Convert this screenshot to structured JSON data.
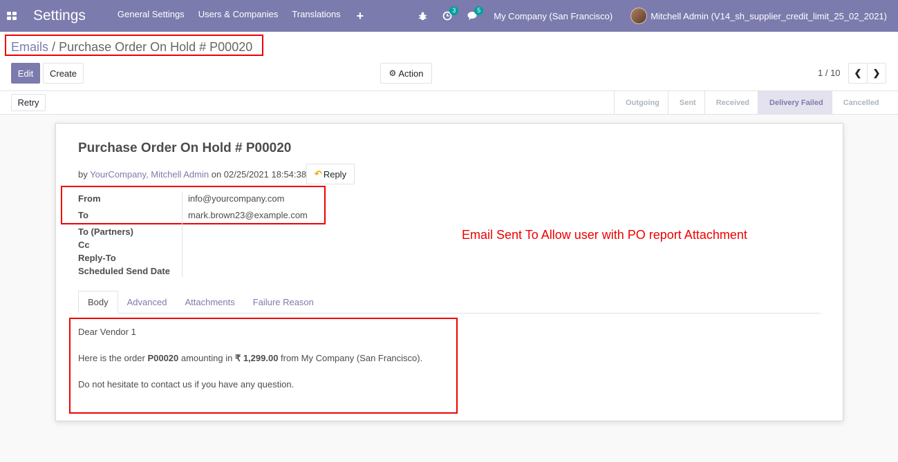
{
  "navbar": {
    "app_title": "Settings",
    "menu": [
      "General Settings",
      "Users & Companies",
      "Translations"
    ],
    "plus": "+",
    "activity_badge": "3",
    "messages_badge": "5",
    "company": "My Company (San Francisco)",
    "user": "Mitchell Admin (V14_sh_supplier_credit_limit_25_02_2021)",
    "accent_color": "#7c7bad"
  },
  "breadcrumb": {
    "parent": "Emails",
    "separator": "/",
    "current": "Purchase Order On Hold # P00020"
  },
  "control": {
    "edit_label": "Edit",
    "create_label": "Create",
    "action_label": "Action",
    "pager": "1 / 10"
  },
  "statusbar": {
    "retry_label": "Retry",
    "stages": [
      "Outgoing",
      "Sent",
      "Received",
      "Delivery Failed",
      "Cancelled"
    ],
    "active_stage": "Delivery Failed"
  },
  "mail": {
    "subject": "Purchase Order On Hold # P00020",
    "by_prefix": "by",
    "author": "YourCompany, Mitchell Admin",
    "on_text": "on 02/25/2021 18:54:38",
    "reply_label": "Reply",
    "fields": [
      {
        "label": "From",
        "value": "info@yourcompany.com"
      },
      {
        "label": "To",
        "value": "mark.brown23@example.com"
      },
      {
        "label": "To (Partners)",
        "value": ""
      },
      {
        "label": "Cc",
        "value": ""
      },
      {
        "label": "Reply-To",
        "value": ""
      },
      {
        "label": "Scheduled Send Date",
        "value": ""
      }
    ],
    "annotation": "Email Sent To Allow user with PO report Attachment"
  },
  "tabs": [
    "Body",
    "Advanced",
    "Attachments",
    "Failure Reason"
  ],
  "body": {
    "greeting": "Dear Vendor 1",
    "line2_prefix": "Here is the order ",
    "order_ref": "P00020",
    "line2_mid": " amounting in ",
    "amount": "₹ 1,299.00",
    "line2_suffix": " from My Company (San Francisco).",
    "line3": "Do not hesitate to contact us if you have any question."
  }
}
